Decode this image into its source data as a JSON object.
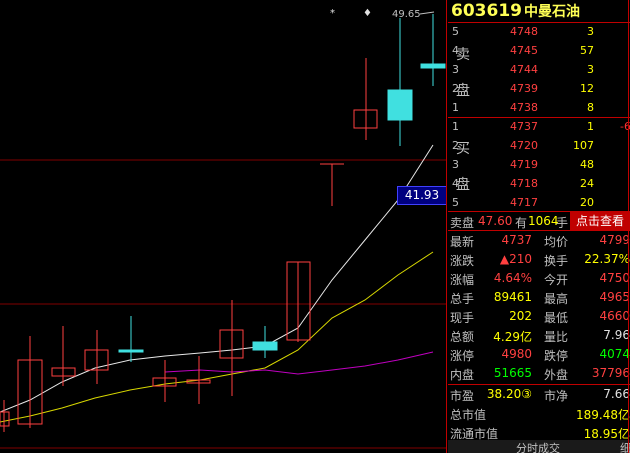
{
  "stock": {
    "code": "603619",
    "name": "中曼石油"
  },
  "chart": {
    "high_label": "49.65",
    "price_marker": "41.93",
    "top_marks": [
      "*",
      "♦"
    ]
  },
  "book": {
    "sell_label_1": "卖",
    "sell_label_2": "盘",
    "buy_label_1": "买",
    "buy_label_2": "盘",
    "sell": [
      {
        "level": "5",
        "price": "4748",
        "volume": "3"
      },
      {
        "level": "4",
        "price": "4745",
        "volume": "57"
      },
      {
        "level": "3",
        "price": "4744",
        "volume": "3"
      },
      {
        "level": "2",
        "price": "4739",
        "volume": "12"
      },
      {
        "level": "1",
        "price": "4738",
        "volume": "8"
      }
    ],
    "buy": [
      {
        "level": "1",
        "price": "4737",
        "volume": "1",
        "change": "-6"
      },
      {
        "level": "2",
        "price": "4720",
        "volume": "107",
        "change": ""
      },
      {
        "level": "3",
        "price": "4719",
        "volume": "48",
        "change": ""
      },
      {
        "level": "4",
        "price": "4718",
        "volume": "24",
        "change": ""
      },
      {
        "level": "5",
        "price": "4717",
        "volume": "20",
        "change": ""
      }
    ]
  },
  "sellbar": {
    "label": "卖盘",
    "price": "47.60",
    "has": "有",
    "qty": "1064",
    "unit": "手",
    "button": "点击查看"
  },
  "stats": [
    {
      "l1": "最新",
      "v1": "4737",
      "c1": "red",
      "l2": "均价",
      "v2": "4799",
      "c2": "red"
    },
    {
      "l1": "涨跌",
      "v1": "▲210",
      "c1": "red",
      "l2": "换手",
      "v2": "22.37%",
      "c2": "yel"
    },
    {
      "l1": "涨幅",
      "v1": "4.64%",
      "c1": "red",
      "l2": "今开",
      "v2": "4750",
      "c2": "red"
    },
    {
      "l1": "总手",
      "v1": "89461",
      "c1": "yel",
      "l2": "最高",
      "v2": "4965",
      "c2": "red"
    },
    {
      "l1": "现手",
      "v1": "202",
      "c1": "yel",
      "l2": "最低",
      "v2": "4660",
      "c2": "red"
    },
    {
      "l1": "总额",
      "v1": "4.29亿",
      "c1": "yel",
      "l2": "量比",
      "v2": "7.96",
      "c2": "wht"
    },
    {
      "l1": "涨停",
      "v1": "4980",
      "c1": "red",
      "l2": "跌停",
      "v2": "4074",
      "c2": "grn"
    },
    {
      "l1": "内盘",
      "v1": "51665",
      "c1": "grn",
      "l2": "外盘",
      "v2": "37796",
      "c2": "red"
    }
  ],
  "extra": [
    {
      "l1": "市盈",
      "v1": "38.20③",
      "c1": "yel",
      "l2": "市净",
      "v2": "7.66",
      "c2": "wht"
    },
    {
      "l1": "总市值",
      "v1": "",
      "c1": "yel",
      "l2": "",
      "v2": "189.48亿",
      "c2": "yel"
    },
    {
      "l1": "流通市值",
      "v1": "",
      "c1": "yel",
      "l2": "",
      "v2": "18.95亿",
      "c2": "yel"
    }
  ],
  "tabs": {
    "t1": "分时成交",
    "t2": "细"
  }
}
